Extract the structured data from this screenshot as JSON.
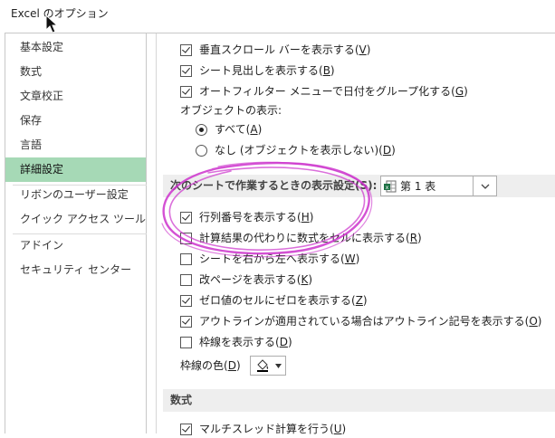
{
  "window": {
    "title": "Excel のオプション"
  },
  "sidebar": {
    "items": [
      {
        "label": "基本設定"
      },
      {
        "label": "数式"
      },
      {
        "label": "文章校正"
      },
      {
        "label": "保存"
      },
      {
        "label": "言語"
      },
      {
        "label": "詳細設定",
        "active": true
      },
      {
        "label": "リボンのユーザー設定"
      },
      {
        "label": "クイック アクセス ツール バー"
      },
      {
        "label": "アドイン"
      },
      {
        "label": "セキュリティ センター"
      }
    ]
  },
  "options": {
    "vscroll": {
      "text": "垂直スクロール バーを表示する(",
      "key": "V",
      "end": ")",
      "checked": true
    },
    "sheet_tabs": {
      "text": "シート見出しを表示する(",
      "key": "B",
      "end": ")",
      "checked": true
    },
    "autofilter": {
      "text": "オートフィルター メニューで日付をグループ化する(",
      "key": "G",
      "end": ")",
      "checked": true
    },
    "objects_label": "オブジェクトの表示:",
    "obj_all": {
      "text": "すべて(",
      "key": "A",
      "end": ")",
      "selected": true
    },
    "obj_none": {
      "text": "なし (オブジェクトを表示しない)(",
      "key": "D",
      "end": ")",
      "selected": false
    }
  },
  "sheet_section": {
    "heading": "次のシートで作業するときの表示設定(S):",
    "sheet_select": "第 1 表",
    "row_col_headers": {
      "text": "行列番号を表示する(",
      "key": "H",
      "end": ")",
      "checked": true
    },
    "formulas": {
      "text": "計算結果の代わりに数式をセルに表示する(",
      "key": "R",
      "end": ")",
      "checked": false
    },
    "rtl": {
      "text": "シートを右から左へ表示する(",
      "key": "W",
      "end": ")",
      "checked": false
    },
    "page_breaks": {
      "text": "改ページを表示する(",
      "key": "K",
      "end": ")",
      "checked": false
    },
    "zero_values": {
      "text": "ゼロ値のセルにゼロを表示する(",
      "key": "Z",
      "end": ")",
      "checked": true
    },
    "outline": {
      "text": "アウトラインが適用されている場合はアウトライン記号を表示する(",
      "key": "O",
      "end": ")",
      "checked": true
    },
    "gridlines": {
      "text": "枠線を表示する(",
      "key": "D",
      "end": ")",
      "checked": false
    },
    "grid_color_label": {
      "text": "枠線の色(",
      "key": "D",
      "end": ")"
    }
  },
  "formulas_section": {
    "heading": "数式",
    "multithread": {
      "text": "マルチスレッド計算を行う(",
      "key": "U",
      "end": ")",
      "checked": true
    }
  },
  "colors": {
    "active_bg": "#a6d9b6",
    "annotation": "#cc33cc",
    "excel_green": "#1e7145"
  }
}
